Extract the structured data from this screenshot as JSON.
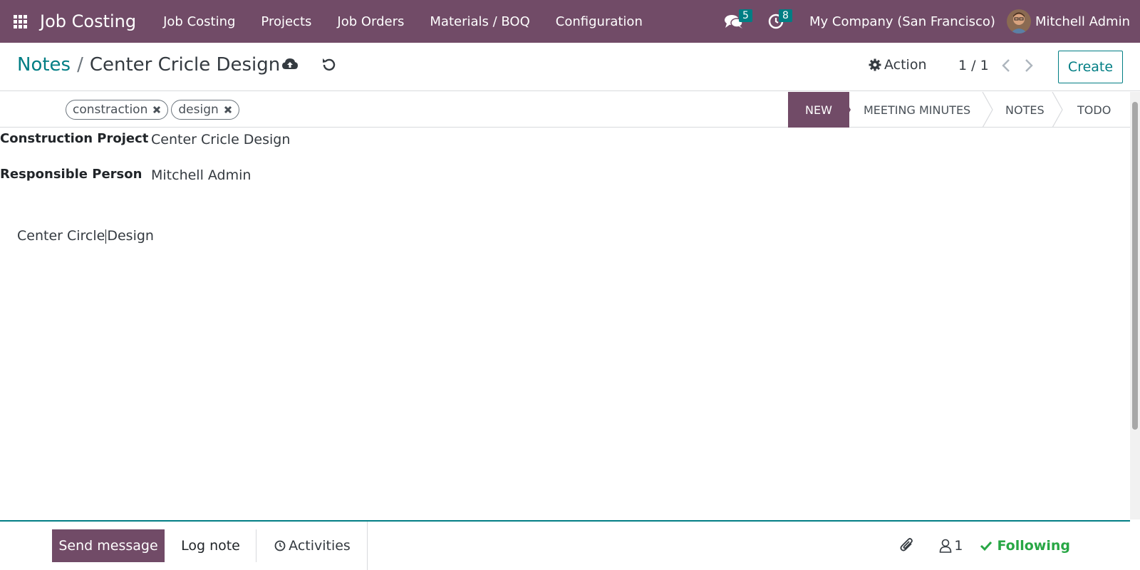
{
  "navbar": {
    "app_name": "Job Costing",
    "menu": [
      "Job Costing",
      "Projects",
      "Job Orders",
      "Materials / BOQ",
      "Configuration"
    ],
    "messages_count": "5",
    "activities_count": "8",
    "company": "My Company (San Francisco)",
    "user": "Mitchell Admin",
    "bar_color": "#714B67"
  },
  "control": {
    "breadcrumb_parent": "Notes",
    "breadcrumb_separator": "/",
    "breadcrumb_current": "Center Cricle Design",
    "action_label": "Action",
    "pager": "1 / 1",
    "create_label": "Create",
    "accent_color": "#017e84"
  },
  "tags": [
    "constraction",
    "design"
  ],
  "stages": [
    "NEW",
    "MEETING MINUTES",
    "NOTES",
    "TODO"
  ],
  "active_stage": "NEW",
  "form": {
    "project_label": "Construction Project",
    "project_value": "Center Cricle Design",
    "responsible_label": "Responsible Person",
    "responsible_value": "Mitchell Admin",
    "note_before_cursor": "Center Circle",
    "note_after_cursor": "Design"
  },
  "chatter": {
    "send_message": "Send message",
    "log_note": "Log note",
    "activities": "Activities",
    "followers_count": "1",
    "following": "Following"
  }
}
